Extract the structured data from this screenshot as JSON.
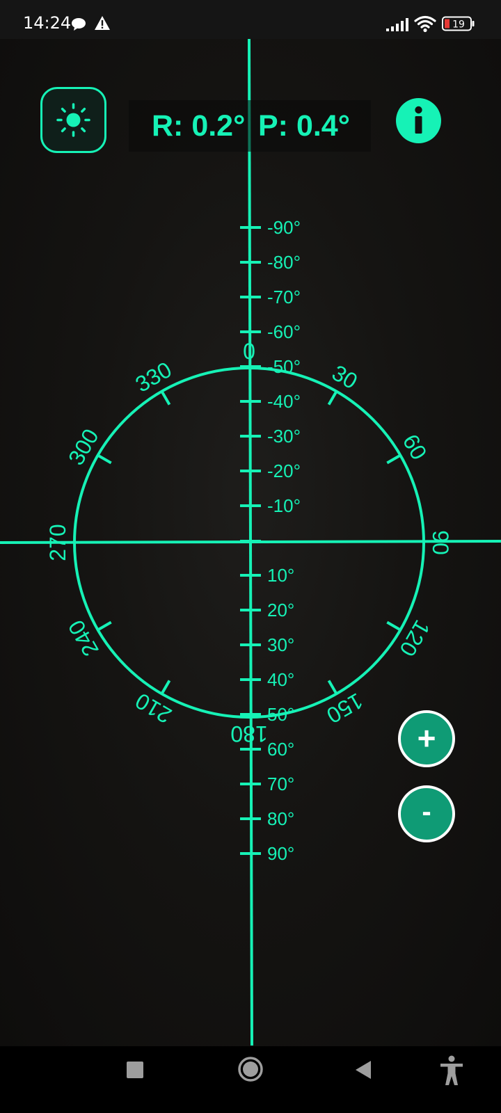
{
  "status_bar": {
    "time": "14:24",
    "battery_level": "19",
    "icons": [
      "chat-bubble-icon",
      "warning-icon",
      "signal-icon",
      "wifi-icon",
      "battery-icon"
    ]
  },
  "readout": {
    "roll": "R: 0.2°",
    "pitch": "P: 0.4°"
  },
  "controls": {
    "brightness_icon": "sun-icon",
    "info_icon": "info-icon",
    "zoom_in_label": "+",
    "zoom_out_label": "-"
  },
  "pitch_scale": {
    "negative_labels": [
      "-90°",
      "-80°",
      "-70°",
      "-60°",
      "-50°",
      "-40°",
      "-30°",
      "-20°",
      "-10°"
    ],
    "positive_labels": [
      "10°",
      "20°",
      "30°",
      "40°",
      "50°",
      "60°",
      "70°",
      "80°",
      "90°"
    ]
  },
  "compass_dial": {
    "labels": [
      "0",
      "30",
      "60",
      "90",
      "120",
      "150",
      "180",
      "210",
      "240",
      "270",
      "300",
      "330"
    ]
  },
  "nav_bar": {
    "items": [
      "recents-square-icon",
      "home-circle-icon",
      "back-triangle-icon",
      "accessibility-icon"
    ]
  },
  "colors": {
    "accent": "#16f2b6",
    "zoom_button_fill": "#0f9b75",
    "background": "#151412"
  }
}
